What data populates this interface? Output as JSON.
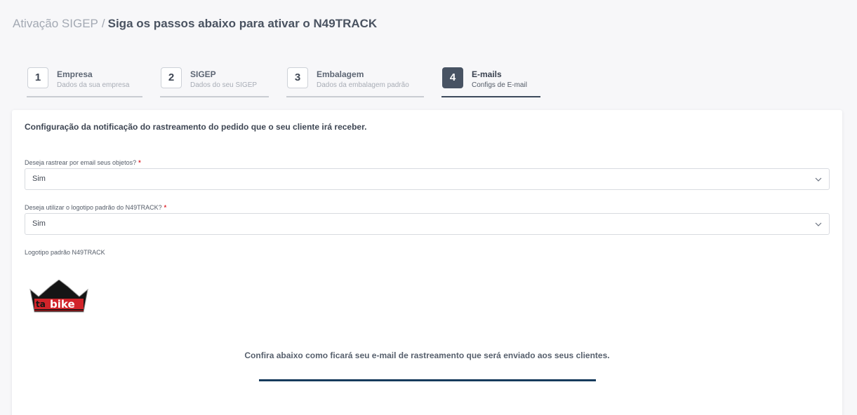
{
  "header": {
    "breadcrumb_root": "Ativação SIGEP",
    "separator": "/",
    "title": "Siga os passos abaixo para ativar o N49TRACK"
  },
  "steps": [
    {
      "number": "1",
      "label": "Empresa",
      "sub": "Dados da sua empresa",
      "active": false
    },
    {
      "number": "2",
      "label": "SIGEP",
      "sub": "Dados do seu SIGEP",
      "active": false
    },
    {
      "number": "3",
      "label": "Embalagem",
      "sub": "Dados da embalagem padrão",
      "active": false
    },
    {
      "number": "4",
      "label": "E-mails",
      "sub": "Configs de E-mail",
      "active": true
    }
  ],
  "card": {
    "title": "Configuração da notificação do rastreamento do pedido que o seu cliente irá receber.",
    "fields": [
      {
        "label": "Deseja rastrear por email seus objetos?",
        "required_mark": "*",
        "value": "Sim"
      },
      {
        "label": "Deseja utilizar o logotipo padrão do N49TRACK?",
        "required_mark": "*",
        "value": "Sim"
      }
    ],
    "logo_label": "Logotipo padrão N49TRACK",
    "logo_text": {
      "prefix": "ta",
      "suffix": "bike"
    },
    "preview_text": "Confira abaixo como ficará seu e-mail de rastreamento que será enviado aos seus clientes."
  },
  "colors": {
    "active_step": "#485363",
    "required": "#e0252b",
    "preview_bar": "#163a5c",
    "logo_red": "#d1242a"
  },
  "icons": {
    "select_arrow": "chevron-down-icon"
  }
}
